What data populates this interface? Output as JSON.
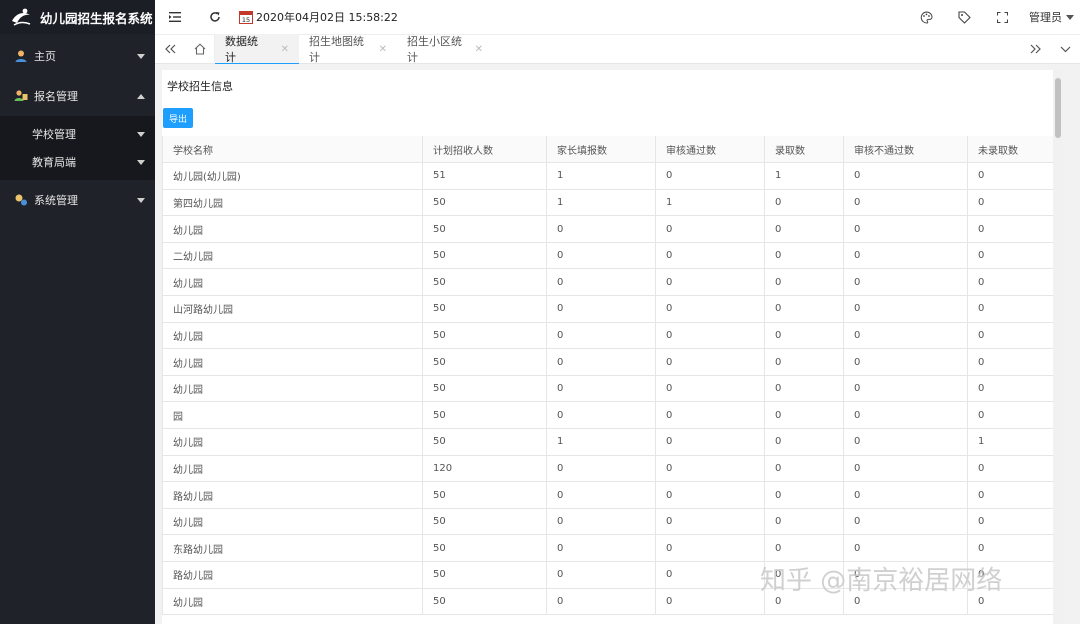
{
  "app": {
    "title": "幼儿园招生报名系统"
  },
  "sidebar": {
    "items": [
      {
        "label": "主页",
        "icon": "user-icon",
        "expanded": false
      },
      {
        "label": "报名管理",
        "icon": "signup-icon",
        "expanded": true,
        "children": [
          {
            "label": "学校管理"
          },
          {
            "label": "教育局端"
          }
        ]
      },
      {
        "label": "系统管理",
        "icon": "system-icon",
        "expanded": false
      }
    ]
  },
  "header": {
    "datetime": "2020年04月02日 15:58:22",
    "calendar_day": "15",
    "user": "管理员"
  },
  "tabs": [
    {
      "label": "数据统计",
      "active": true
    },
    {
      "label": "招生地图统计",
      "active": false
    },
    {
      "label": "招生小区统计",
      "active": false
    }
  ],
  "main": {
    "title": "学校招生信息",
    "export_label": "导出",
    "table": {
      "columns": [
        "学校名称",
        "计划招收人数",
        "家长填报数",
        "审核通过数",
        "录取数",
        "审核不通过数",
        "未录取数"
      ],
      "rows": [
        [
          "幼儿园(幼儿园)",
          "51",
          "1",
          "0",
          "1",
          "0",
          "0"
        ],
        [
          "第四幼儿园",
          "50",
          "1",
          "1",
          "0",
          "0",
          "0"
        ],
        [
          "幼儿园",
          "50",
          "0",
          "0",
          "0",
          "0",
          "0"
        ],
        [
          "二幼儿园",
          "50",
          "0",
          "0",
          "0",
          "0",
          "0"
        ],
        [
          "幼儿园",
          "50",
          "0",
          "0",
          "0",
          "0",
          "0"
        ],
        [
          "山河路幼儿园",
          "50",
          "0",
          "0",
          "0",
          "0",
          "0"
        ],
        [
          "幼儿园",
          "50",
          "0",
          "0",
          "0",
          "0",
          "0"
        ],
        [
          "幼儿园",
          "50",
          "0",
          "0",
          "0",
          "0",
          "0"
        ],
        [
          "幼儿园",
          "50",
          "0",
          "0",
          "0",
          "0",
          "0"
        ],
        [
          "园",
          "50",
          "0",
          "0",
          "0",
          "0",
          "0"
        ],
        [
          "幼儿园",
          "50",
          "1",
          "0",
          "0",
          "0",
          "1"
        ],
        [
          "幼儿园",
          "120",
          "0",
          "0",
          "0",
          "0",
          "0"
        ],
        [
          "路幼儿园",
          "50",
          "0",
          "0",
          "0",
          "0",
          "0"
        ],
        [
          "幼儿园",
          "50",
          "0",
          "0",
          "0",
          "0",
          "0"
        ],
        [
          "东路幼儿园",
          "50",
          "0",
          "0",
          "0",
          "0",
          "0"
        ],
        [
          "路幼儿园",
          "50",
          "0",
          "0",
          "0",
          "0",
          "0"
        ],
        [
          "幼儿园",
          "50",
          "0",
          "0",
          "0",
          "0",
          "0"
        ]
      ]
    }
  },
  "watermark": "知乎 @南京裕居网络",
  "colors": {
    "accent": "#1e9fff",
    "sidebar_bg": "#20222a"
  }
}
